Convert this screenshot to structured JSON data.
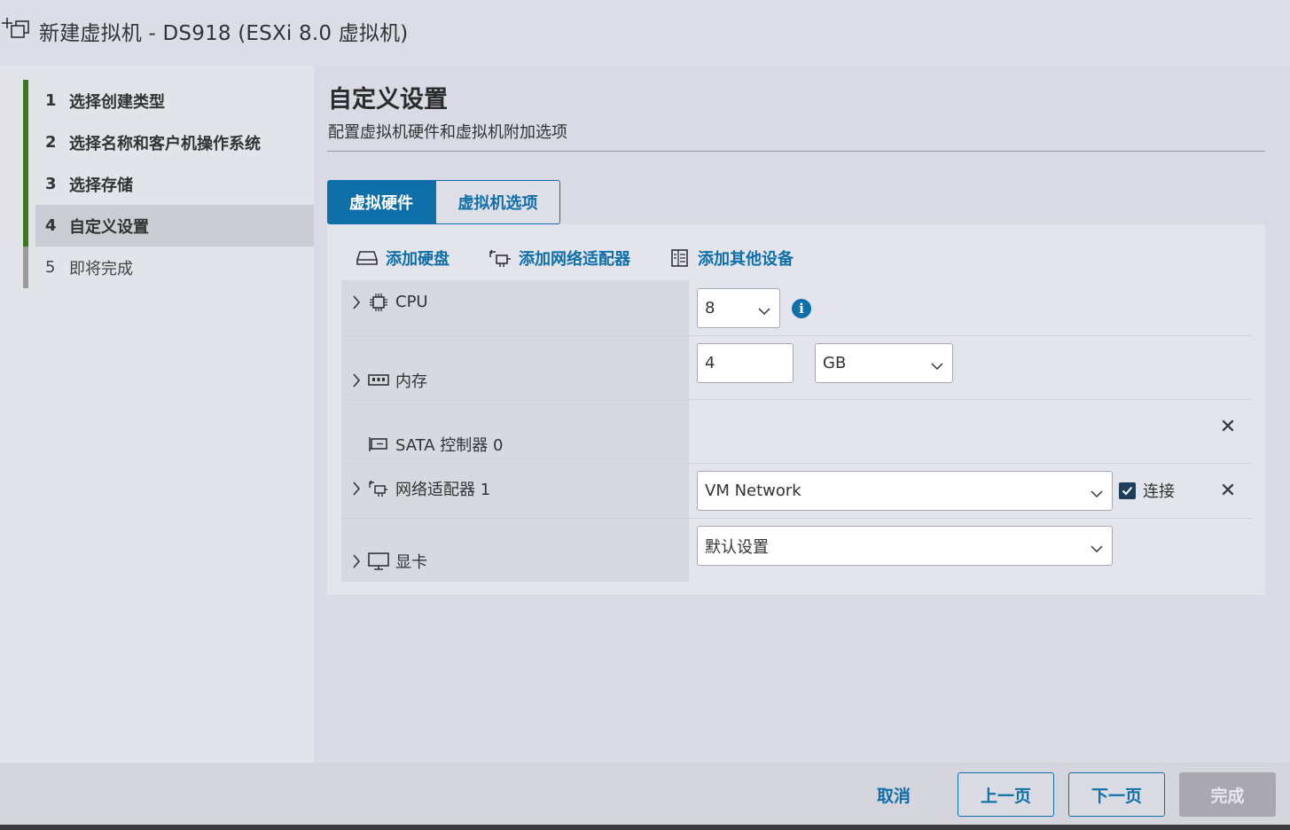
{
  "window": {
    "title": "新建虚拟机 - DS918 (ESXi 8.0 虚拟机)"
  },
  "steps": [
    {
      "num": "1",
      "label": "选择创建类型",
      "state": "done"
    },
    {
      "num": "2",
      "label": "选择名称和客户机操作系统",
      "state": "done"
    },
    {
      "num": "3",
      "label": "选择存储",
      "state": "done"
    },
    {
      "num": "4",
      "label": "自定义设置",
      "state": "active"
    },
    {
      "num": "5",
      "label": "即将完成",
      "state": "pending"
    }
  ],
  "main": {
    "heading": "自定义设置",
    "subheading": "配置虚拟机硬件和虚拟机附加选项",
    "tabs": [
      {
        "label": "虚拟硬件",
        "selected": true
      },
      {
        "label": "虚拟机选项",
        "selected": false
      }
    ],
    "toolbar": {
      "add_disk": "添加硬盘",
      "add_network": "添加网络适配器",
      "add_other": "添加其他设备"
    },
    "hardware": {
      "cpu": {
        "label": "CPU",
        "value": "8"
      },
      "memory": {
        "label": "内存",
        "value": "4",
        "unit": "GB"
      },
      "sata": {
        "label": "SATA 控制器 0"
      },
      "network": {
        "label": "网络适配器 1",
        "value": "VM Network",
        "connect_label": "连接",
        "connected": true
      },
      "display": {
        "label": "显卡",
        "value": "默认设置"
      }
    }
  },
  "footer": {
    "cancel": "取消",
    "back": "上一页",
    "next": "下一页",
    "finish": "完成"
  },
  "colors": {
    "accent": "#0f6fa8",
    "done": "#3a7a1c",
    "pending": "#9b9b9b"
  }
}
